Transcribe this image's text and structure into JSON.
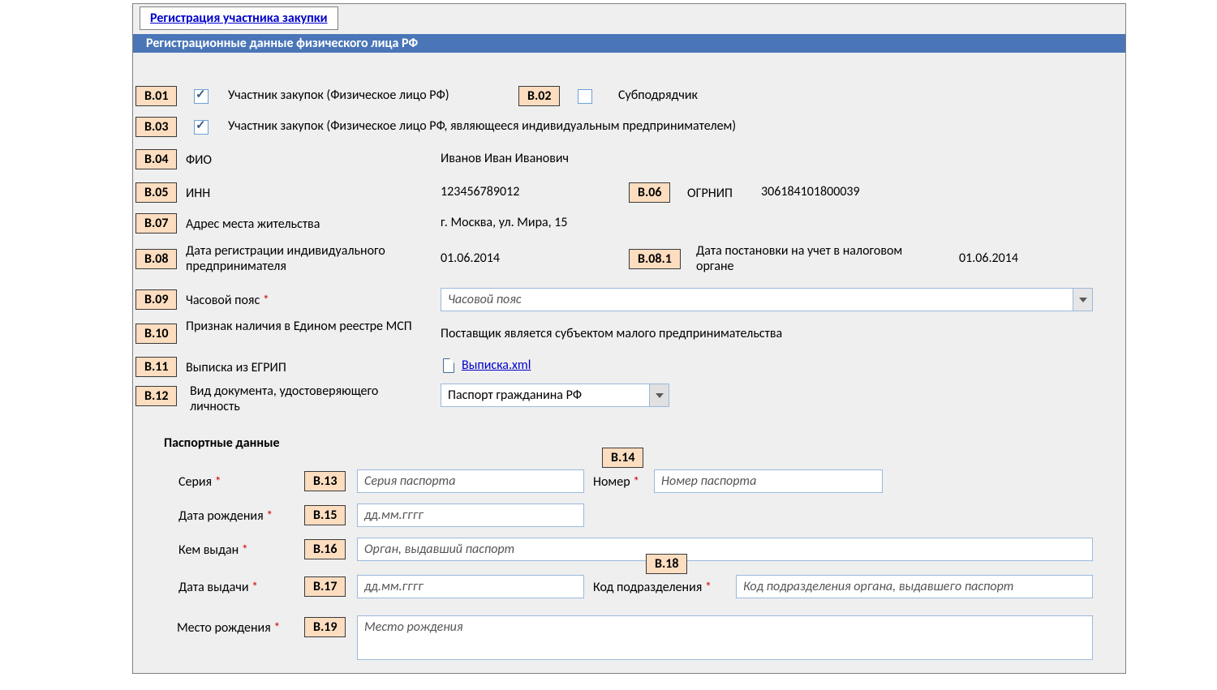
{
  "tab_link": "Регистрация участника закупки",
  "section_title": "Регистрационные данные физического лица РФ",
  "badges": {
    "b01": "B.01",
    "b02": "B.02",
    "b03": "B.03",
    "b04": "B.04",
    "b05": "B.05",
    "b06": "B.06",
    "b07": "B.07",
    "b08": "B.08",
    "b081": "B.08.1",
    "b09": "B.09",
    "b10": "B.10",
    "b11": "B.11",
    "b12": "B.12",
    "b13": "B.13",
    "b14": "B.14",
    "b15": "B.15",
    "b16": "B.16",
    "b17": "B.17",
    "b18": "B.18",
    "b19": "B.19"
  },
  "labels": {
    "participant_person": "Участник закупок (Физическое лицо РФ)",
    "subcontractor": "Субподрядчик",
    "participant_ip": "Участник закупок (Физическое лицо РФ, являющееся индивидуальным предпринимателем)",
    "fio": "ФИО",
    "inn": "ИНН",
    "ogrnip": "ОГРНИП",
    "address": "Адрес места жительства",
    "reg_date_ip": "Дата регистрации индивидуального предпринимателя",
    "tax_reg_date": "Дата постановки на учет в налоговом органе",
    "timezone": "Часовой пояс",
    "msp_flag": "Признак наличия в Едином реестре МСП",
    "egrip": "Выписка из ЕГРИП",
    "doc_type": "Вид документа, удостоверяющего личность",
    "passport_data": "Паспортные данные",
    "series": "Серия",
    "number": "Номер",
    "birth_date": "Дата рождения",
    "issued_by": "Кем выдан",
    "issue_date": "Дата выдачи",
    "dept_code": "Код подразделения",
    "birth_place": "Место рождения"
  },
  "values": {
    "fio": "Иванов Иван Иванович",
    "inn": "123456789012",
    "ogrnip": "306184101800039",
    "address": "г. Москва, ул. Мира, 15",
    "reg_date_ip": "01.06.2014",
    "tax_reg_date": "01.06.2014",
    "msp": "Поставщик является субъектом малого предпринимательства",
    "file_link": "Выписка.xml",
    "doc_type": "Паспорт гражданина РФ"
  },
  "placeholders": {
    "timezone": "Часовой пояс",
    "series": "Серия паспорта",
    "number": "Номер паспорта",
    "date": "дд.мм.гггг",
    "issued_by": "Орган, выдавший паспорт",
    "dept_code": "Код подразделения органа, выдавшего паспорт",
    "birth_place": "Место рождения"
  },
  "asterisk": "*"
}
